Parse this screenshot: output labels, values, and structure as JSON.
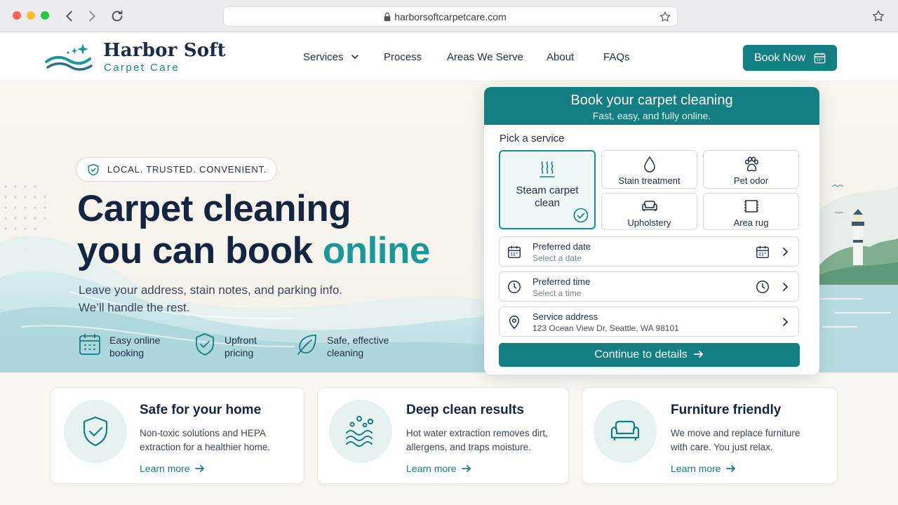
{
  "browser": {
    "url": "harborsoftcarpetcare.com"
  },
  "brand": {
    "name": "Harbor Soft",
    "tagline": "Carpet Care"
  },
  "nav": {
    "items": [
      "Services",
      "Process",
      "Areas We Serve",
      "About",
      "FAQs"
    ],
    "book_label": "Book Now"
  },
  "hero": {
    "badge": "LOCAL. TRUSTED. CONVENIENT.",
    "headline_line1": "Carpet cleaning",
    "headline_line2_plain": "you can book ",
    "headline_line2_accent": "online",
    "lead_line1": "Leave your address, stain notes, and parking info.",
    "lead_line2": "We’ll handle the rest.",
    "features": [
      {
        "label": "Easy online\nbooking",
        "icon": "calendar-icon"
      },
      {
        "label": "Upfront\npricing",
        "icon": "shield-check-icon"
      },
      {
        "label": "Safe, effective\ncleaning",
        "icon": "leaf-icon"
      }
    ]
  },
  "booking": {
    "title": "Book your carpet cleaning",
    "subtitle": "Fast, easy, and fully online.",
    "pick_label": "Pick a service",
    "services": [
      {
        "label": "Steam carpet clean",
        "icon": "steam-icon",
        "selected": true
      },
      {
        "label": "Stain treatment",
        "icon": "droplet-icon",
        "selected": false
      },
      {
        "label": "Pet odor",
        "icon": "paw-icon",
        "selected": false
      },
      {
        "label": "Upholstery",
        "icon": "sofa-icon",
        "selected": false
      },
      {
        "label": "Area rug",
        "icon": "rug-icon",
        "selected": false
      }
    ],
    "date": {
      "title": "Preferred date",
      "value": "Select a date"
    },
    "time": {
      "title": "Preferred time",
      "value": "Select a time"
    },
    "address": {
      "title": "Service address",
      "value": "123 Ocean View Dr, Seattle, WA 98101"
    },
    "continue_label": "Continue to details"
  },
  "features": [
    {
      "title": "Safe for your home",
      "desc": "Non-toxic solutions and HEPA extraction for a healthier home.",
      "link": "Learn more",
      "icon": "shield-check-icon"
    },
    {
      "title": "Deep clean results",
      "desc": "Hot water extraction removes dirt, allergens, and traps moisture.",
      "link": "Learn more",
      "icon": "water-bubbles-icon"
    },
    {
      "title": "Furniture friendly",
      "desc": "We move and replace furniture with care. You just relax.",
      "link": "Learn more",
      "icon": "sofa-icon"
    }
  ],
  "colors": {
    "brand_teal": "#137f83",
    "accent_teal": "#17999a",
    "navy": "#142542"
  }
}
